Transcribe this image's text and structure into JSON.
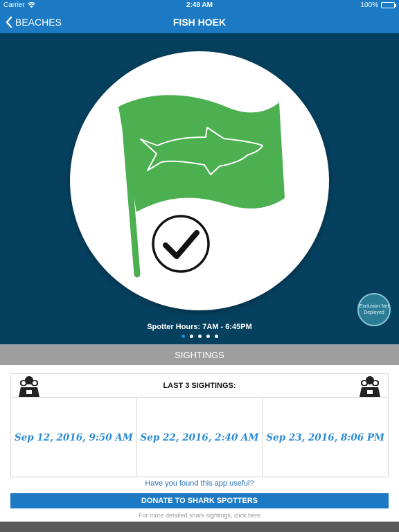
{
  "status_bar": {
    "carrier": "Carrier",
    "time": "2:48 AM",
    "battery": "100%"
  },
  "nav": {
    "back_label": "BEACHES",
    "title": "FISH HOEK"
  },
  "hero": {
    "flag_color": "#4caf50",
    "background_color": "#05405e",
    "status_icon": "check-icon",
    "exclusion_net": "Exclusion Net Deployed",
    "spotter_hours": "Spotter Hours: 7AM - 6:45PM",
    "page_count": 5,
    "active_page": 1
  },
  "sightings": {
    "header": "SIGHTINGS",
    "card_title": "LAST 3 SIGHTINGS:",
    "items": [
      "Sep 12, 2016, 9:50 AM",
      "Sep 22, 2016, 2:40 AM",
      "Sep 23, 2016, 8:06 PM"
    ]
  },
  "footer": {
    "useful_text": "Have you found this app useful?",
    "donate_label": "DONATE TO SHARK SPOTTERS",
    "more_text": "For more detailed shark sightings, click here"
  },
  "colors": {
    "accent": "#1c7ac4",
    "sighting_text": "#2a8bd6"
  }
}
